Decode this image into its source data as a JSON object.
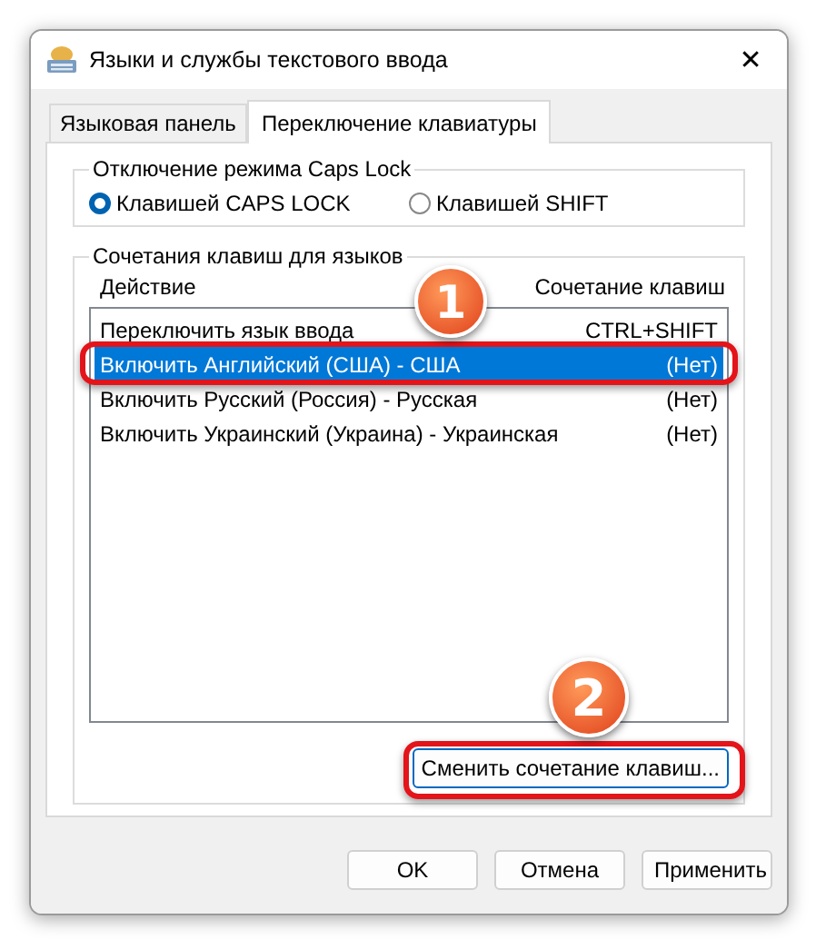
{
  "window": {
    "title": "Языки и службы текстового ввода",
    "close": "✕"
  },
  "tabs": [
    {
      "label": "Языковая панель",
      "selected": false
    },
    {
      "label": "Переключение клавиатуры",
      "selected": true
    }
  ],
  "caps_lock_group": {
    "title": "Отключение режима Caps Lock",
    "options": [
      {
        "label": "Клавишей CAPS LOCK",
        "selected": true
      },
      {
        "label": "Клавишей SHIFT",
        "selected": false
      }
    ]
  },
  "hotkeys_group": {
    "title": "Сочетания клавиш для языков",
    "columns": [
      "Действие",
      "Сочетание клавиш"
    ],
    "rows": [
      {
        "action": "Переключить язык ввода",
        "keys": "CTRL+SHIFT",
        "selected": false
      },
      {
        "action": "Включить Английский (США) - США",
        "keys": "(Нет)",
        "selected": true
      },
      {
        "action": "Включить Русский (Россия) - Русская",
        "keys": "(Нет)",
        "selected": false
      },
      {
        "action": "Включить Украинский (Украина) - Украинская",
        "keys": "(Нет)",
        "selected": false
      }
    ],
    "change_button": "Сменить сочетание клавиш..."
  },
  "buttons": [
    "OK",
    "Отмена",
    "Применить"
  ],
  "callouts": [
    "1",
    "2"
  ]
}
